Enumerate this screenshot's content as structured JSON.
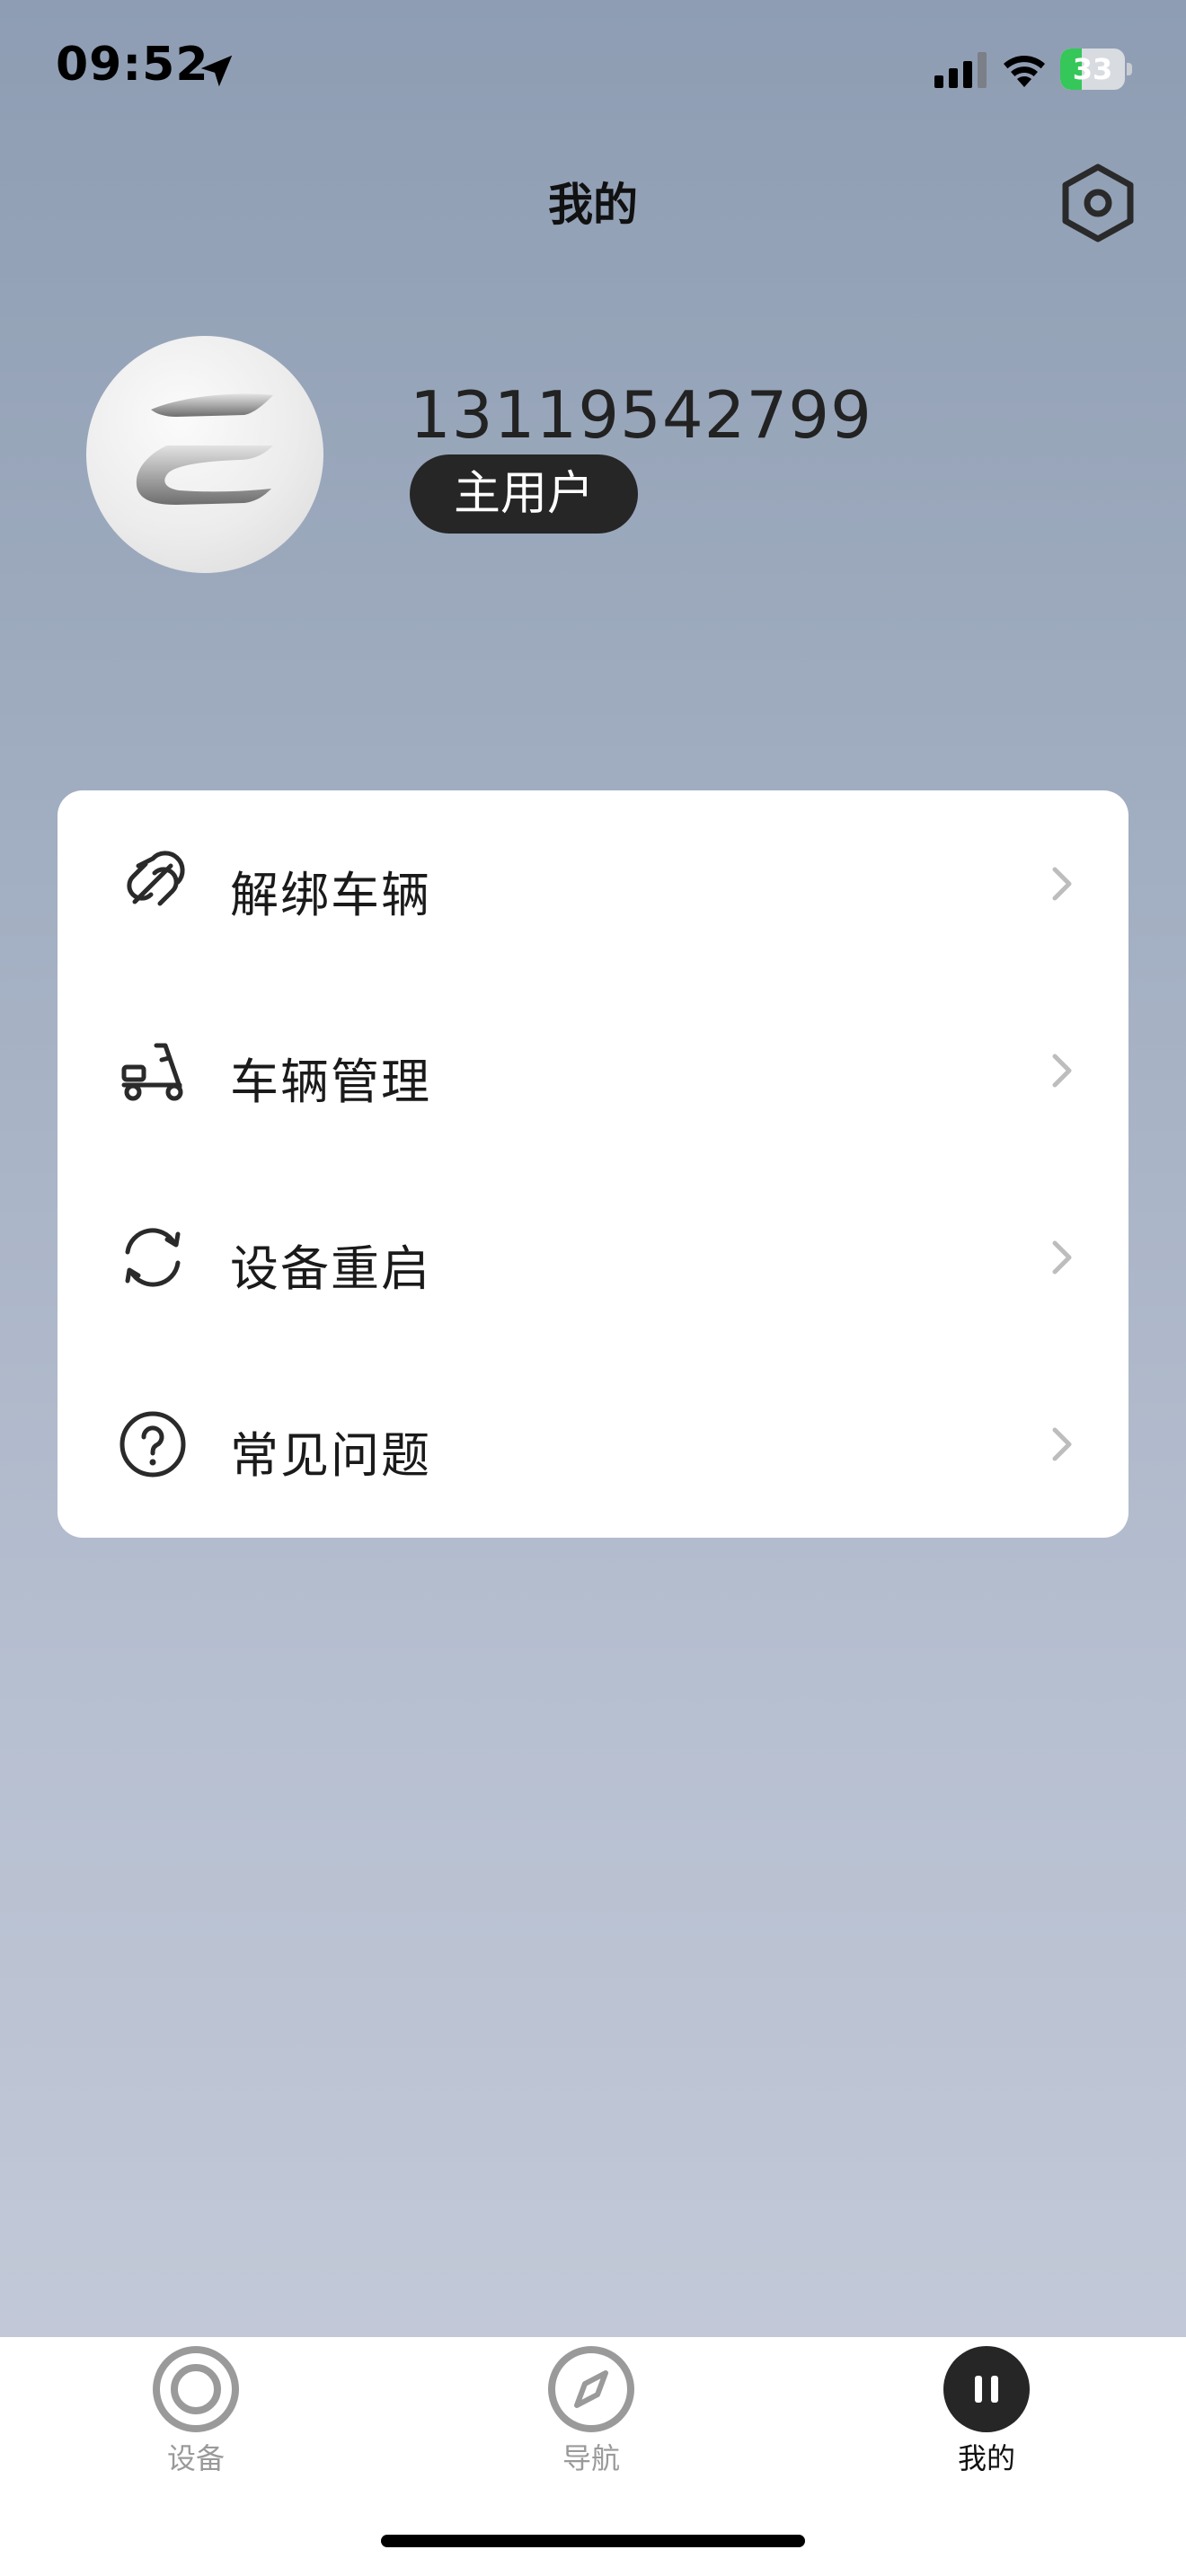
{
  "status_bar": {
    "time": "09:52",
    "battery": "33",
    "battery_level": 0.33,
    "icons": [
      "location-arrow-icon",
      "signal-icon",
      "wifi-icon",
      "battery-charging-icon"
    ]
  },
  "header": {
    "title": "我的",
    "settings_icon": "gear-hexagon-icon"
  },
  "profile": {
    "phone": "13119542799",
    "role": "主用户",
    "avatar": "brand-logo-avatar"
  },
  "menu": {
    "items": [
      {
        "label": "解绑车辆",
        "icon": "unlink-pill-icon"
      },
      {
        "label": "车辆管理",
        "icon": "scooter-icon"
      },
      {
        "label": "设备重启",
        "icon": "refresh-icon"
      },
      {
        "label": "常见问题",
        "icon": "question-circle-icon"
      }
    ]
  },
  "tab_bar": {
    "tabs": [
      {
        "label": "设备",
        "icon": "device-ring-icon",
        "active": false
      },
      {
        "label": "导航",
        "icon": "compass-icon",
        "active": false
      },
      {
        "label": "我的",
        "icon": "pause-circle-icon",
        "active": true
      }
    ]
  },
  "colors": {
    "active_tab": "#262626",
    "inactive_tab": "#9a9a9a",
    "battery": "#35c759"
  }
}
